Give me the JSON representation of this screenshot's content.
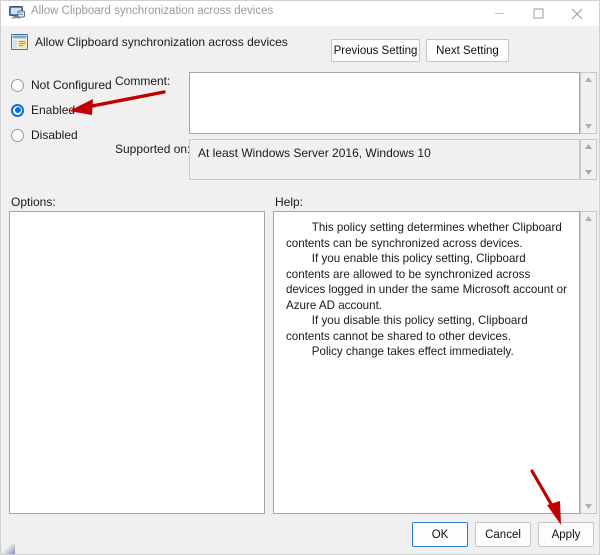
{
  "window": {
    "title": "Allow Clipboard synchronization across devices",
    "title_icon": "monitor-policy-icon",
    "controls": {
      "minimize": "minimize-icon",
      "maximize": "maximize-icon",
      "close": "close-icon"
    }
  },
  "header": {
    "icon": "policy-setting-icon",
    "title": "Allow Clipboard synchronization across devices",
    "previous_setting_label": "Previous Setting",
    "next_setting_label": "Next Setting"
  },
  "state_options": [
    {
      "id": "not-configured",
      "label": "Not Configured",
      "selected": false
    },
    {
      "id": "enabled",
      "label": "Enabled",
      "selected": true
    },
    {
      "id": "disabled",
      "label": "Disabled",
      "selected": false
    }
  ],
  "comment": {
    "label": "Comment:",
    "value": "",
    "placeholder": ""
  },
  "supported_on": {
    "label": "Supported on:",
    "value": "At least Windows Server 2016, Windows 10"
  },
  "options": {
    "label": "Options:",
    "value": ""
  },
  "help": {
    "label": "Help:",
    "text": "        This policy setting determines whether Clipboard contents can be synchronized across devices.\n        If you enable this policy setting, Clipboard contents are allowed to be synchronized across devices logged in under the same Microsoft account or Azure AD account.\n        If you disable this policy setting, Clipboard contents cannot be shared to other devices.\n        Policy change takes effect immediately."
  },
  "footer": {
    "ok_label": "OK",
    "cancel_label": "Cancel",
    "apply_label": "Apply"
  },
  "annotations": {
    "accent_color": "#c00000",
    "arrow_to_enabled": "red-arrow-pointing-to-enabled",
    "arrow_to_apply": "red-arrow-pointing-to-apply"
  },
  "colors": {
    "dialog_background": "#f0f0f0",
    "field_background": "#ffffff",
    "radio_selected": "#0a6fd6",
    "focus_border": "#2b7cd3",
    "annotation_red": "#c00000"
  }
}
